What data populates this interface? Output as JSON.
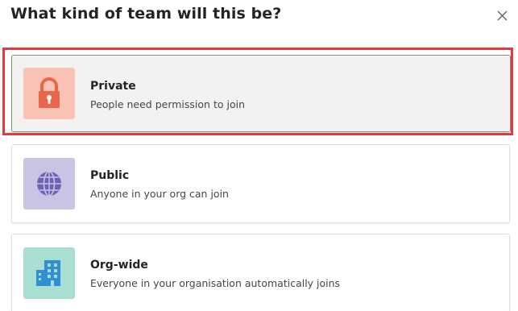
{
  "dialog": {
    "title": "What kind of team will this be?",
    "close_icon": "close-icon"
  },
  "options": [
    {
      "title": "Private",
      "description": "People need permission to join",
      "icon": "lock-icon",
      "tile_color": "#f8c3b4",
      "icon_color": "#e8674b",
      "selected": true
    },
    {
      "title": "Public",
      "description": "Anyone in your org can join",
      "icon": "globe-icon",
      "tile_color": "#c9c4e4",
      "icon_color": "#6c62b6",
      "selected": false
    },
    {
      "title": "Org-wide",
      "description": "Everyone in your organisation automatically joins",
      "icon": "building-icon",
      "tile_color": "#a9dfd3",
      "icon_color": "#2f8ed6",
      "selected": false
    }
  ],
  "colors": {
    "selection_outline": "#e8393a"
  }
}
